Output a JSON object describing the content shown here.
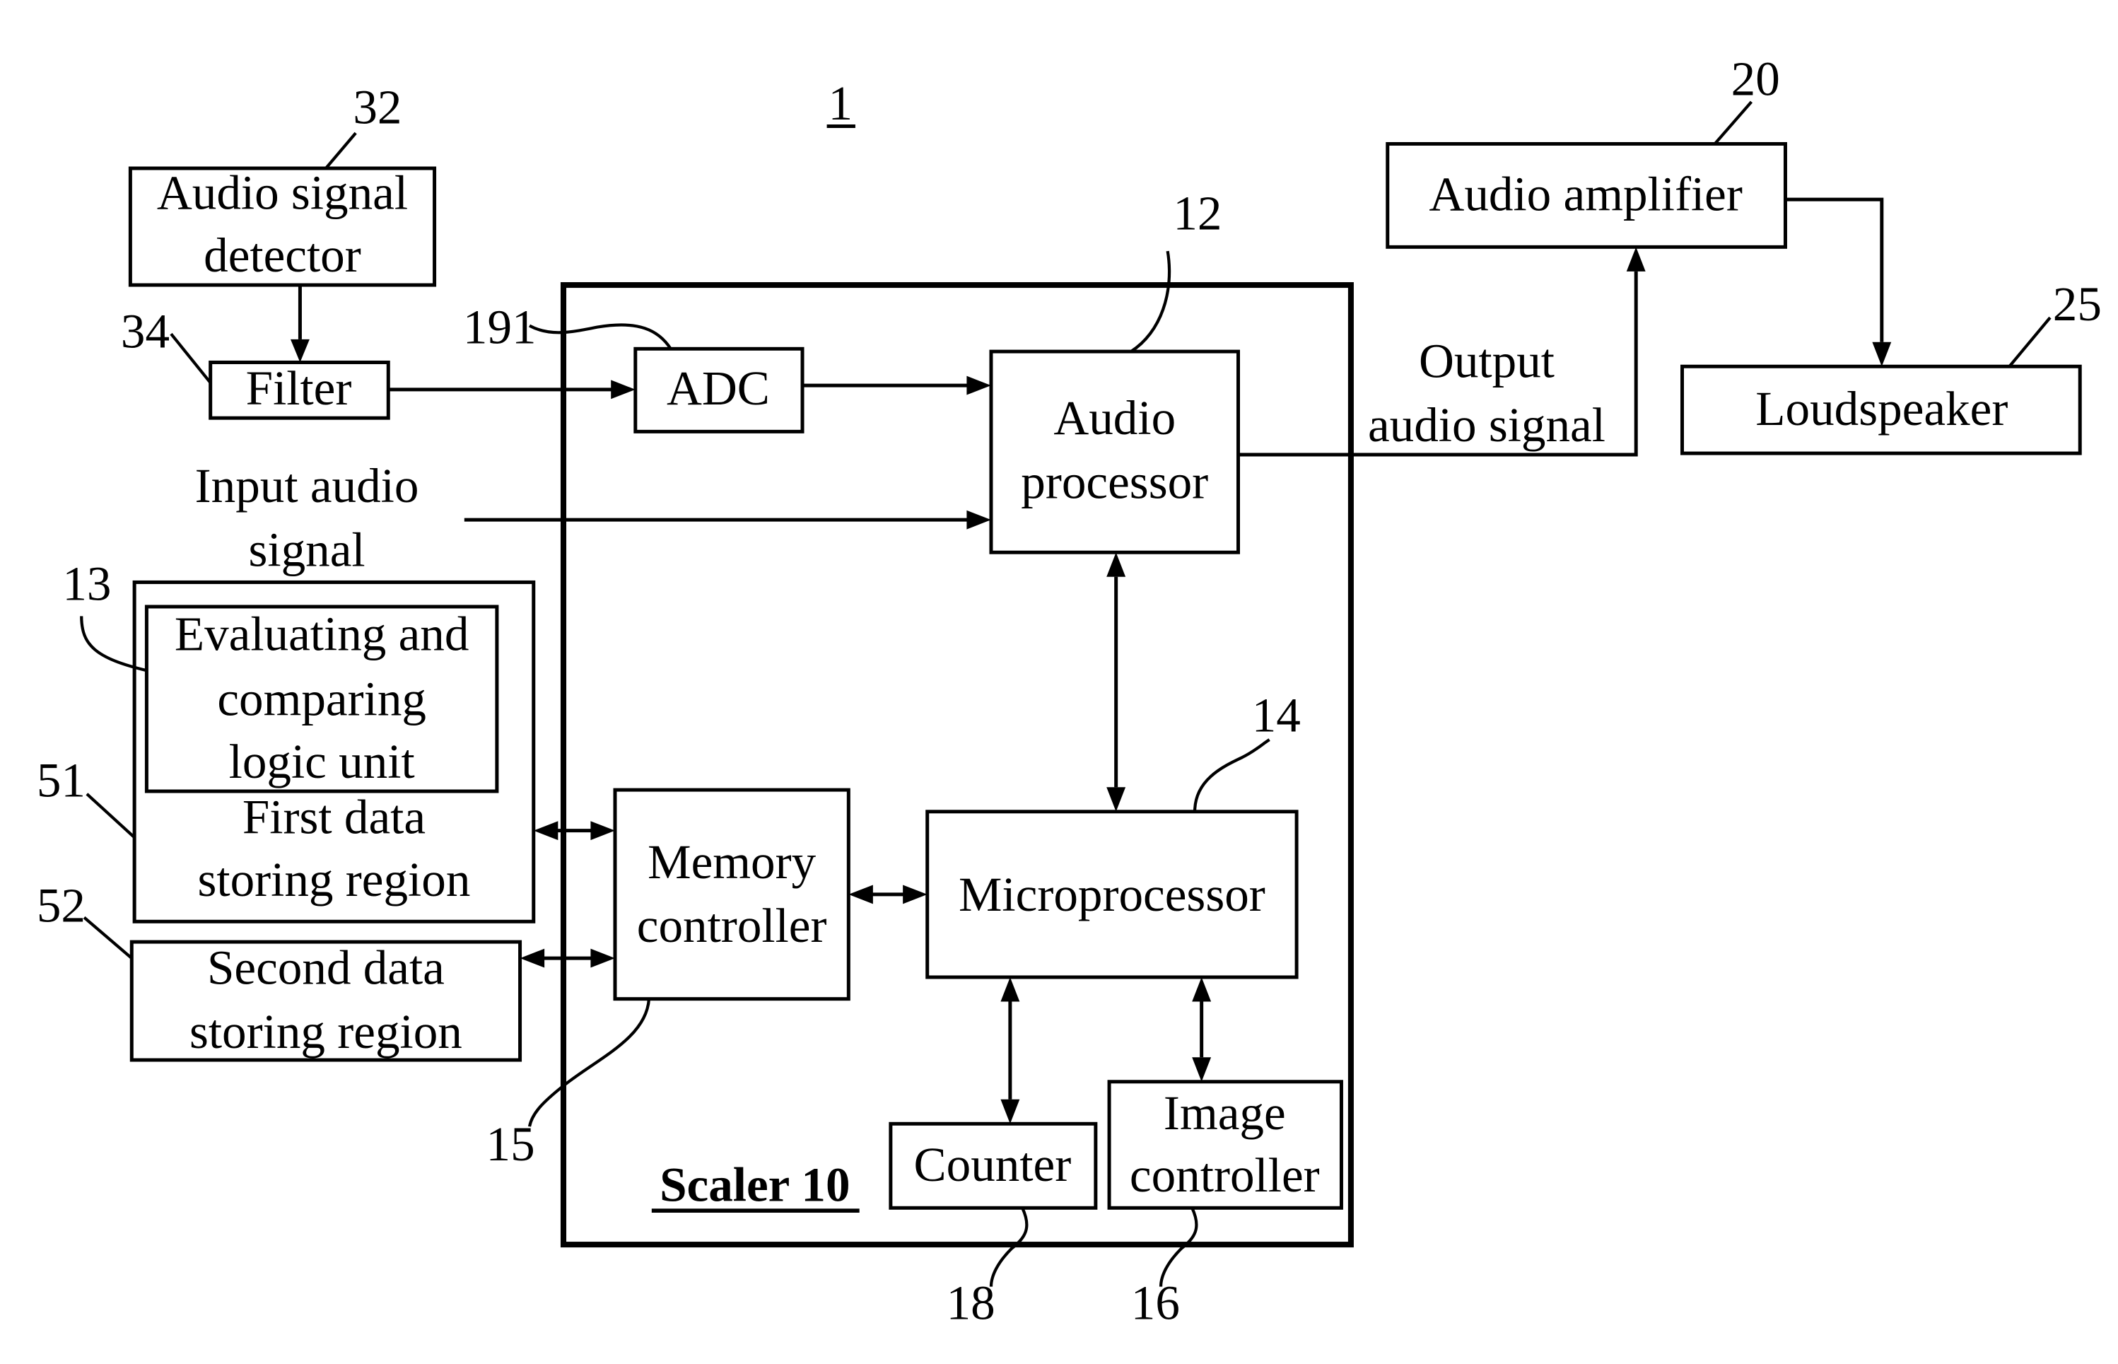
{
  "figure": {
    "figure_ref": "1",
    "scaler_label": "Scaler 10",
    "blocks": {
      "audio_signal_detector": {
        "lines": [
          "Audio signal",
          "detector"
        ],
        "ref": "32"
      },
      "filter": {
        "lines": [
          "Filter"
        ],
        "ref": "34"
      },
      "adc": {
        "lines": [
          "ADC"
        ],
        "ref": "191"
      },
      "audio_processor": {
        "lines": [
          "Audio",
          "processor"
        ],
        "ref": "12"
      },
      "audio_amplifier": {
        "lines": [
          "Audio amplifier"
        ],
        "ref": "20"
      },
      "loudspeaker": {
        "lines": [
          "Loudspeaker"
        ],
        "ref": "25"
      },
      "first_data_storing_region": {
        "lines": [
          "First data",
          "storing region"
        ],
        "ref": "51"
      },
      "evaluating_logic_unit": {
        "lines": [
          "Evaluating and",
          "comparing",
          "logic unit"
        ],
        "ref": "13"
      },
      "second_data_storing_region": {
        "lines": [
          "Second data",
          "storing region"
        ],
        "ref": "52"
      },
      "memory_controller": {
        "lines": [
          "Memory",
          "controller"
        ],
        "ref": "15"
      },
      "microprocessor": {
        "lines": [
          "Microprocessor"
        ],
        "ref": "14"
      },
      "counter": {
        "lines": [
          "Counter"
        ],
        "ref": "18"
      },
      "image_controller": {
        "lines": [
          "Image",
          "controller"
        ],
        "ref": "16"
      }
    },
    "signals": {
      "input_audio_signal": [
        "Input audio",
        "signal"
      ],
      "output_audio_signal": [
        "Output",
        "audio signal"
      ]
    }
  }
}
